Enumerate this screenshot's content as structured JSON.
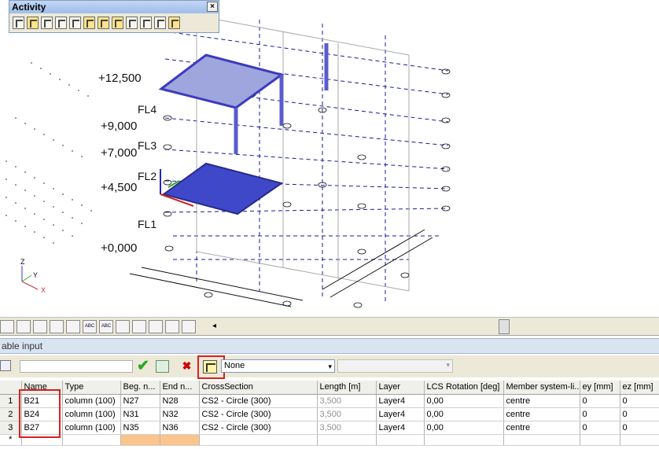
{
  "activity": {
    "title": "Activity",
    "close": "×",
    "icons": [
      "grid-icon",
      "grid-edit-icon",
      "grid-copy-icon",
      "grid-disabled-icon",
      "grid-disabled-icon",
      "grid-view-icon",
      "grid-search-icon",
      "grid-check-icon",
      "grid-disabled-icon",
      "grid-disabled-icon",
      "grid-disabled-icon",
      "grid-frame-icon"
    ]
  },
  "viewport": {
    "levels": [
      "+12,500",
      "+9,000",
      "+7,000",
      "+4,500",
      "+0,000"
    ],
    "floors": [
      "FL4",
      "FL3",
      "FL2",
      "FL1"
    ],
    "axis": {
      "z": "Z",
      "y": "Y",
      "x": "X"
    }
  },
  "tab_strip": {
    "icons": [
      "ABC",
      "ABC"
    ],
    "arrow": "◂"
  },
  "panel": {
    "title": "able input",
    "filter_value": "",
    "select_value": "None",
    "select_caret": "▾",
    "disabled_select_value": ""
  },
  "table": {
    "columns": [
      "",
      "Name",
      "Type",
      "Beg. n...",
      "End n...",
      "CrossSection",
      "Length [m]",
      "Layer",
      "LCS Rotation [deg]",
      "Member system-li...",
      "ey [mm]",
      "ez [mm]"
    ],
    "rows": [
      [
        "1",
        "B21",
        "column (100)",
        "N27",
        "N28",
        "CS2 - Circle (300)",
        "3,500",
        "Layer4",
        "0,00",
        "centre",
        "0",
        "0"
      ],
      [
        "2",
        "B24",
        "column (100)",
        "N31",
        "N32",
        "CS2 - Circle (300)",
        "3,500",
        "Layer4",
        "0,00",
        "centre",
        "0",
        "0"
      ],
      [
        "3",
        "B27",
        "column (100)",
        "N35",
        "N36",
        "CS2 - Circle (300)",
        "3,500",
        "Layer4",
        "0,00",
        "centre",
        "0",
        "0"
      ]
    ],
    "new_row_marker": "*"
  }
}
